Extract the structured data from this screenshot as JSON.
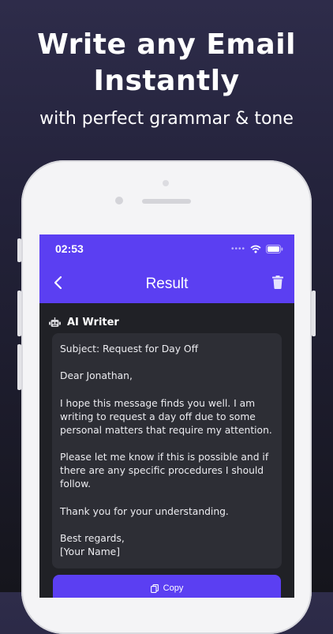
{
  "promo": {
    "headline_line1": "Write any Email",
    "headline_line2": "Instantly",
    "subhead": "with perfect grammar & tone"
  },
  "status_bar": {
    "time": "02:53",
    "icons": [
      "signal-dots-icon",
      "wifi-icon",
      "battery-icon"
    ]
  },
  "app_bar": {
    "title": "Result",
    "back_icon": "chevron-left-icon",
    "delete_icon": "trash-icon",
    "color": "#5b3ff2"
  },
  "section": {
    "label": "AI Writer",
    "icon": "robot-icon"
  },
  "email": {
    "lines": [
      "Subject: Request for Day Off",
      "Dear Jonathan,",
      "I hope this message finds you well. I am",
      "writing to request a day off due to some",
      "personal matters that require my attention.",
      "Please let me know if this is possible and if",
      "there are any specific procedures I should",
      "follow.",
      "Thank you for your understanding.",
      "Best regards,",
      "[Your Name]"
    ]
  },
  "copy_button": {
    "label": "Copy",
    "icon": "copy-icon"
  }
}
